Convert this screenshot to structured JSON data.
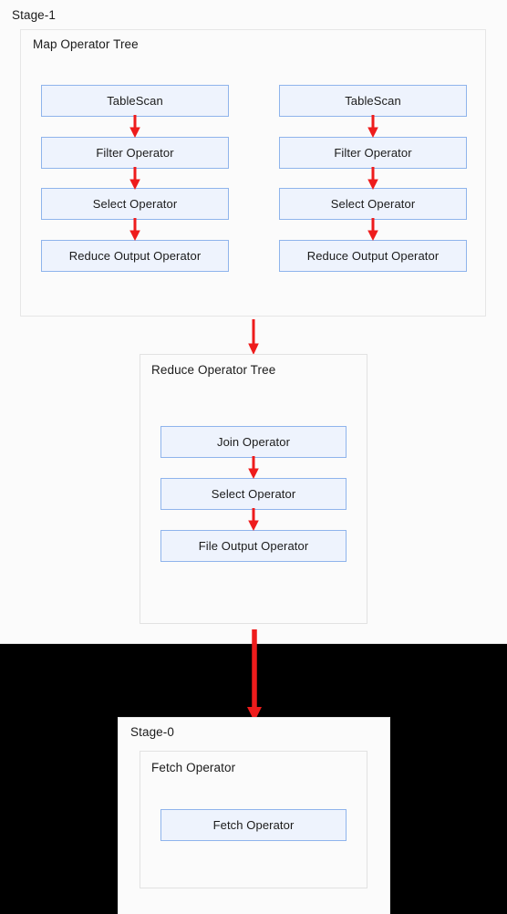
{
  "colors": {
    "node_fill": "#eef3fd",
    "node_border": "#8fb4ec",
    "arrow": "#ee1c1c",
    "panel_bg": "#fbfbfb",
    "panel_border": "#e2e2e2",
    "page_bg": "#000000",
    "text": "#1b1b1b"
  },
  "stage1": {
    "label": "Stage-1",
    "map_tree": {
      "label": "Map Operator Tree",
      "branches": [
        {
          "name": "left-branch",
          "nodes": [
            {
              "label": "TableScan"
            },
            {
              "label": "Filter Operator"
            },
            {
              "label": "Select Operator"
            },
            {
              "label": "Reduce Output Operator"
            }
          ]
        },
        {
          "name": "right-branch",
          "nodes": [
            {
              "label": "TableScan"
            },
            {
              "label": "Filter Operator"
            },
            {
              "label": "Select Operator"
            },
            {
              "label": "Reduce Output Operator"
            }
          ]
        }
      ]
    },
    "reduce_tree": {
      "label": "Reduce Operator Tree",
      "nodes": [
        {
          "label": "Join Operator"
        },
        {
          "label": "Select Operator"
        },
        {
          "label": "File Output Operator"
        }
      ]
    }
  },
  "stage0": {
    "label": "Stage-0",
    "fetch_group": {
      "label": "Fetch Operator",
      "nodes": [
        {
          "label": "Fetch Operator"
        }
      ]
    }
  },
  "connectors": [
    {
      "name": "map-left-ts-to-filter"
    },
    {
      "name": "map-left-filter-to-select"
    },
    {
      "name": "map-left-select-to-reduceoutput"
    },
    {
      "name": "map-right-ts-to-filter"
    },
    {
      "name": "map-right-filter-to-select"
    },
    {
      "name": "map-right-select-to-reduceoutput"
    },
    {
      "name": "maptree-to-reducetree"
    },
    {
      "name": "reduce-join-to-select"
    },
    {
      "name": "reduce-select-to-fileoutput"
    },
    {
      "name": "stage1-to-stage0"
    }
  ]
}
